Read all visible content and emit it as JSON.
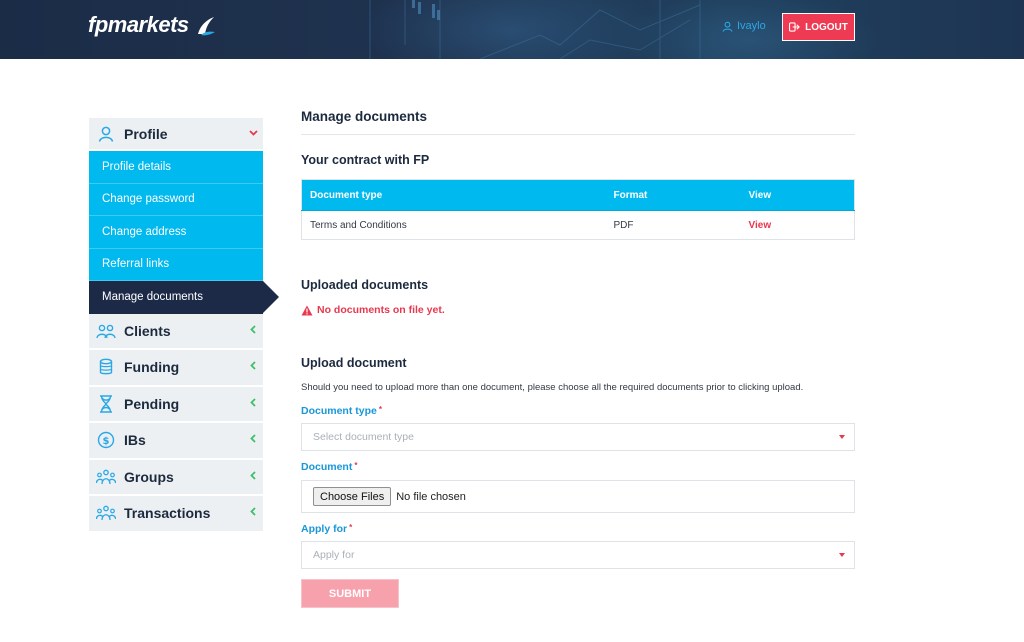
{
  "header": {
    "logo_text": "fpmarkets",
    "user_name": "Ivaylo",
    "logout_label": "LOGOUT"
  },
  "sidebar": {
    "profile": {
      "label": "Profile",
      "items": [
        {
          "label": "Profile details"
        },
        {
          "label": "Change password"
        },
        {
          "label": "Change address"
        },
        {
          "label": "Referral links"
        },
        {
          "label": "Manage documents",
          "active": true
        }
      ]
    },
    "sections": [
      {
        "label": "Clients",
        "icon": "users-icon"
      },
      {
        "label": "Funding",
        "icon": "coins-icon"
      },
      {
        "label": "Pending",
        "icon": "hourglass-icon"
      },
      {
        "label": "IBs",
        "icon": "dollar-circle-icon"
      },
      {
        "label": "Groups",
        "icon": "network-icon"
      },
      {
        "label": "Transactions",
        "icon": "network-icon"
      }
    ]
  },
  "main": {
    "title": "Manage documents",
    "contract_heading": "Your contract with FP",
    "table": {
      "columns": [
        "Document type",
        "Format",
        "View"
      ],
      "rows": [
        {
          "document_type": "Terms and Conditions",
          "format": "PDF",
          "view": "View"
        }
      ]
    },
    "uploaded_heading": "Uploaded documents",
    "no_documents_text": "No documents on file yet.",
    "upload_heading": "Upload document",
    "upload_note": "Should you need to upload more than one document, please choose all the required documents prior to clicking upload.",
    "form": {
      "document_type_label": "Document type",
      "document_type_placeholder": "Select document type",
      "document_label": "Document",
      "choose_files_label": "Choose Files",
      "no_file_text": "No file chosen",
      "apply_for_label": "Apply for",
      "apply_for_placeholder": "Apply for",
      "required_mark": "*",
      "submit_label": "SUBMIT"
    }
  },
  "colors": {
    "accent_blue": "#00b9ef",
    "navy": "#1c2a48",
    "danger_red": "#e8384f",
    "link_blue": "#1897d8"
  }
}
